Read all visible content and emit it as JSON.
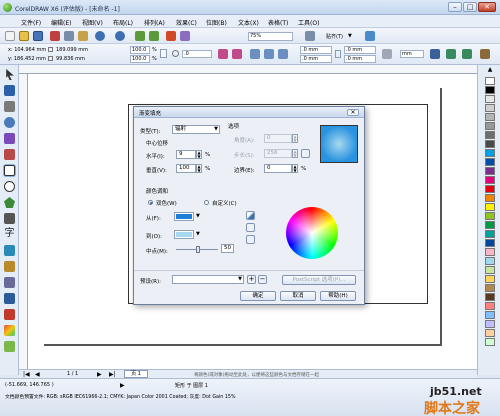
{
  "window": {
    "title": "CorelDRAW X6 (评估版) - [未命名 -1]",
    "minimize": "–",
    "maximize": "□",
    "close": "✕"
  },
  "menu": [
    "文件(F)",
    "编辑(E)",
    "视图(V)",
    "布局(L)",
    "排列(A)",
    "效果(C)",
    "位图(B)",
    "文本(X)",
    "表格(T)",
    "工具(O)"
  ],
  "toolbar1": {
    "zoom": "75%",
    "snap": "贴齐(T)",
    "snap_arrow": "▼"
  },
  "toolbar2": {
    "x": "x: 104.964 mm",
    "y": "y: 186.452 mm",
    "w": "189.099 mm",
    "h": "99.836 mm",
    "scale_w": "100.0",
    "scale_h": "100.0",
    "pct": "%",
    "angle": ".0",
    "r1": ".0 mm",
    "r2": ".0 mm",
    "r3": ".0 mm",
    "r4": ".0 mm",
    "mm": "mm"
  },
  "page_nav": {
    "counter": "1 / 1",
    "tab": "页 1"
  },
  "status": {
    "hint": "将颜色(或对象)拖动至此处，以便将这些颜色与文档存储在一起",
    "coords": "(-51.669, 146.765 )",
    "layer": "矩形 于 图层 1",
    "profile": "文档颜色预置文件: RGB: sRGB IEC61966-2.1; CMYK: Japan Color 2001 Coated; 灰度: Dot Gain 15%"
  },
  "watermark": {
    "site": "jb51.net",
    "name": "脚本之家"
  },
  "dialog": {
    "title": "渐变填充",
    "close": "✕",
    "type_label": "类型(T):",
    "type_value": "辐射",
    "center_offset": "中心位移",
    "horizontal_label": "水平(I):",
    "horizontal_value": "9",
    "vertical_label": "垂直(V):",
    "vertical_value": "100",
    "pct": "%",
    "options": "选项",
    "angle_label": "角度(A):",
    "angle_value": "0",
    "steps_label": "步长(S):",
    "steps_value": "256",
    "edge_label": "边界(E):",
    "edge_value": "0",
    "color_blend": "颜色调和",
    "two_color": "双色(W)",
    "custom": "自定义(C)",
    "from_label": "从(F):",
    "to_label": "到(O):",
    "mid_label": "中点(M):",
    "mid_value": "50",
    "preset_label": "预设(R):",
    "postscript": "PostScript 选项(P)...",
    "ok": "确定",
    "cancel": "取消",
    "help": "帮助(H)",
    "from_color": "#1e7fd8",
    "to_color": "#a8d8f0",
    "preview_color": "#2a93e0"
  },
  "colors": {
    "palette": [
      "#ffffff",
      "#000000",
      "#e5e5e5",
      "#cfcfcf",
      "#b5b5b5",
      "#999999",
      "#6e6e6e",
      "#4a4a4a",
      "#00a0e6",
      "#004ea8",
      "#7c2e8e",
      "#e6007e",
      "#e60012",
      "#f08300",
      "#fff100",
      "#8fc31f",
      "#009944",
      "#00a29a",
      "#00479d",
      "#f8b6c9",
      "#a0d8ef",
      "#c8e6a0",
      "#fdd35c",
      "#b28850",
      "#5a3a1c",
      "#ff7f7f",
      "#7fbfff",
      "#bfbfff",
      "#ffd0a0",
      "#d0ffd0"
    ]
  }
}
